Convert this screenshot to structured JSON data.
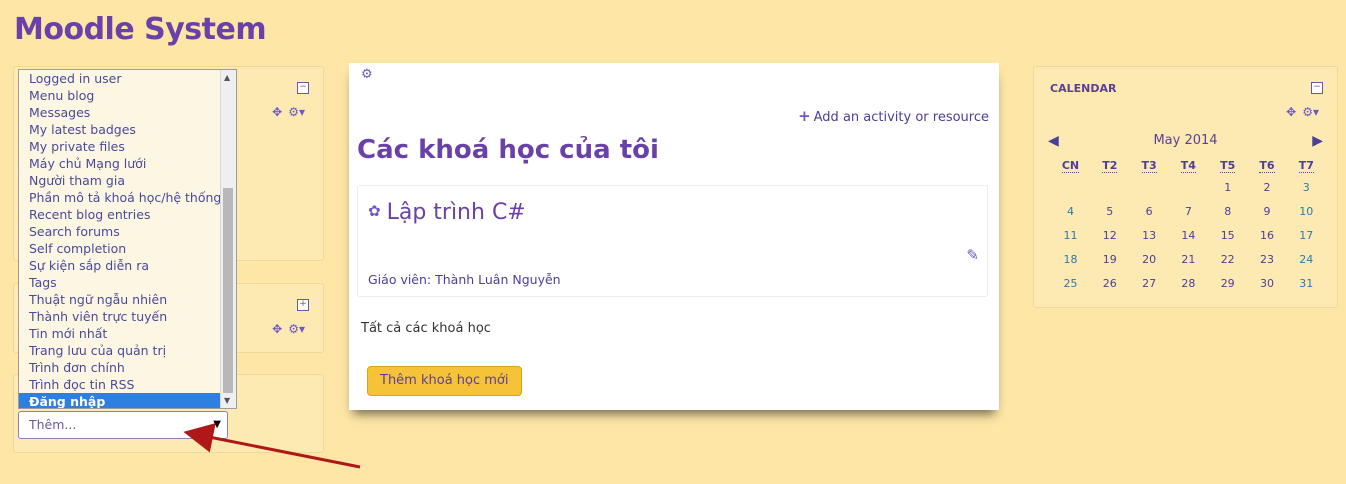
{
  "site": {
    "title": "Moodle System"
  },
  "block_list": {
    "items": [
      "Logged in user",
      "Menu blog",
      "Messages",
      "My latest badges",
      "My private files",
      "Máy chủ Mạng lưới",
      "Người tham gia",
      "Phần mô tả khoá học/hệ thống",
      "Recent blog entries",
      "Search forums",
      "Self completion",
      "Sự kiện sắp diễn ra",
      "Tags",
      "Thuật ngữ ngẫu nhiên",
      "Thành viên trực tuyến",
      "Tin mới nhất",
      "Trang lưu của quản trị",
      "Trình đơn chính",
      "Trình đọc tin RSS",
      "Đăng nhập"
    ],
    "selected": "Đăng nhập",
    "select_value": "Thêm..."
  },
  "main": {
    "add_activity": "Add an activity or resource",
    "heading": "Các khoá học của tôi",
    "course": {
      "title": "Lập trình C#",
      "teacher": "Giáo viên: Thành Luân Nguyễn"
    },
    "all_courses": "Tất cả các khoá học",
    "add_course_button": "Thêm khoá học mới"
  },
  "calendar": {
    "title": "CALENDAR",
    "month": "May 2014",
    "weekdays": [
      "CN",
      "T2",
      "T3",
      "T4",
      "T5",
      "T6",
      "T7"
    ],
    "weeks": [
      [
        "",
        "",
        "",
        "",
        "1",
        "2",
        "3"
      ],
      [
        "4",
        "5",
        "6",
        "7",
        "8",
        "9",
        "10"
      ],
      [
        "11",
        "12",
        "13",
        "14",
        "15",
        "16",
        "17"
      ],
      [
        "18",
        "19",
        "20",
        "21",
        "22",
        "23",
        "24"
      ],
      [
        "25",
        "26",
        "27",
        "28",
        "29",
        "30",
        "31"
      ]
    ]
  },
  "icons": {
    "move": "move-icon",
    "settings": "gear-icon",
    "collapse": "collapse-icon",
    "expand": "expand-icon",
    "edit": "edit-icon",
    "course": "course-icon"
  },
  "colors": {
    "background": "#fde6a6",
    "accent": "#6a41a8",
    "button": "#f6c237",
    "selected": "#2f7fe0",
    "arrow": "#b01818"
  }
}
